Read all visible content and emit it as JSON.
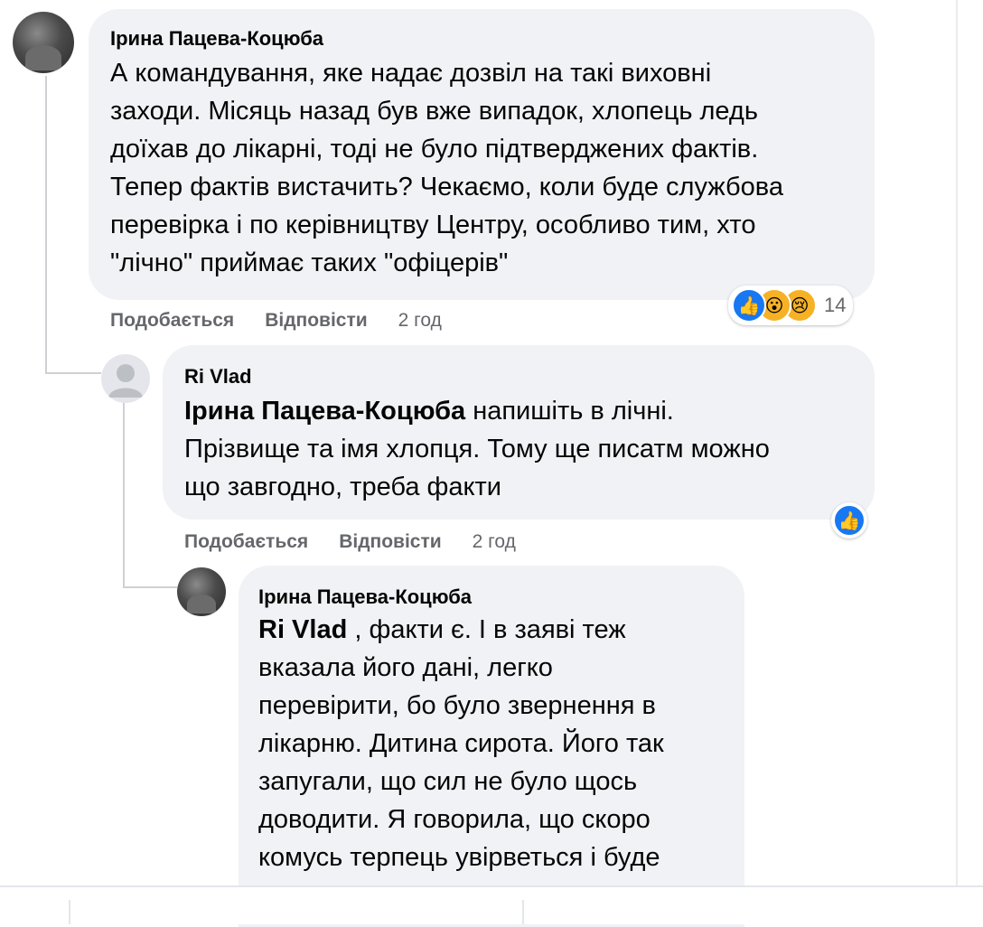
{
  "comments": [
    {
      "author": "Ірина Пацева-Коцюба",
      "lines": [
        "А командування, яке надає дозвіл на такі виховні",
        "заходи. Місяць назад був вже випадок, хлопець ледь",
        "доїхав до лікарні, тоді не було підтверджених фактів.",
        "Тепер фактів вистачить? Чекаємо, коли буде службова",
        "перевірка і по керівництву Центру, особливо тим, хто",
        "\"лічно\" приймає таких \"офіцерів\""
      ],
      "actions": {
        "like": "Подобається",
        "reply": "Відповісти",
        "time": "2 год"
      },
      "reactions": {
        "icons": [
          "like-icon",
          "wow-icon",
          "sad-icon"
        ],
        "count": "14"
      }
    },
    {
      "author": "Ri Vlad",
      "mention": "Ірина Пацева-Коцюба",
      "line1_rest": " напишіть в лічні.",
      "lines": [
        "Прізвище та імя хлопця. Тому ще писатм можно",
        "що завгодно, треба факти"
      ],
      "actions": {
        "like": "Подобається",
        "reply": "Відповісти",
        "time": "2 год"
      },
      "reactions": {
        "icons": [
          "like-icon"
        ]
      }
    },
    {
      "author": "Ірина Пацева-Коцюба",
      "mention": "Ri Vlad",
      "line1_rest": " , факти є. І в заяві теж",
      "lines": [
        "вказала його дані, легко",
        "перевірити, бо було звернення в",
        "лікарню. Дитина сирота. Його так",
        "запугали, що сил не було щось",
        "доводити. Я говорила, що скоро",
        "комусь терпець увірветься і буде"
      ]
    }
  ],
  "colors": {
    "bubble": "#f0f2f5",
    "secondary_text": "#65676b",
    "like_blue": "#1877f2",
    "emoji_yellow": "#f7b125"
  }
}
